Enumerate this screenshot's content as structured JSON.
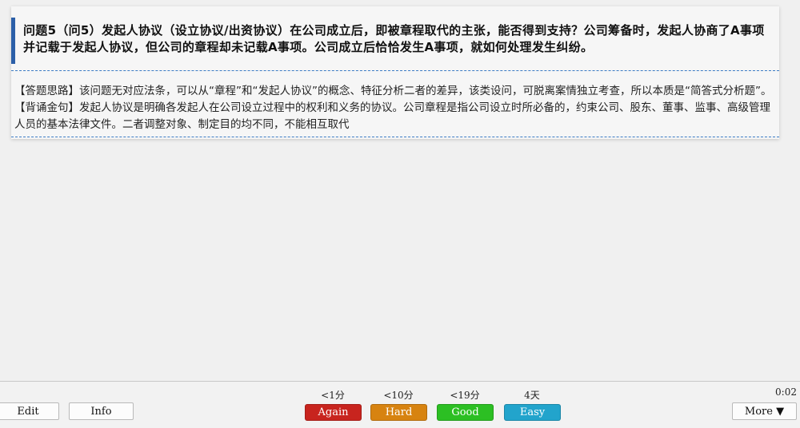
{
  "card": {
    "question": "问题5（问5）发起人协议（设立协议/出资协议）在公司成立后，即被章程取代的主张，能否得到支持？公司筹备时，发起人协商了A事项并记载于发起人协议，但公司的章程却未记载A事项。公司成立后恰恰发生A事项，就如何处理发生纠纷。",
    "answer": "【答题思路】该问题无对应法条，可以从“章程”和“发起人协议”的概念、特征分析二者的差异，该类设问，可脱离案情独立考查，所以本质是“简答式分析题”。【背诵金句】发起人协议是明确各发起人在公司设立过程中的权利和义务的协议。公司章程是指公司设立时所必备的，约束公司、股东、董事、监事、高级管理人员的基本法律文件。二者调整对象、制定目的均不同，不能相互取代"
  },
  "bottombar": {
    "edit_label": "Edit",
    "info_label": "Info",
    "more_label": "More ▼",
    "timer": "0:02",
    "answers": [
      {
        "label": "Again",
        "interval": "<1分",
        "color": "#c8241e"
      },
      {
        "label": "Hard",
        "interval": "<10分",
        "color": "#d78310"
      },
      {
        "label": "Good",
        "interval": "<19分",
        "color": "#2cbf23"
      },
      {
        "label": "Easy",
        "interval": "4天",
        "color": "#22a4cc"
      }
    ]
  },
  "colors": {
    "accent_bar": "#2c5fa8",
    "separator": "#3c7bc4"
  }
}
